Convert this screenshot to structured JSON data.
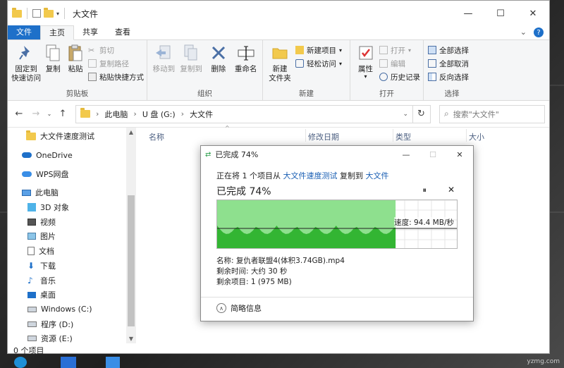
{
  "window": {
    "title": "大文件",
    "controls": {
      "minimize": "—",
      "maximize": "☐",
      "close": "✕"
    }
  },
  "tabs": [
    {
      "label": "文件"
    },
    {
      "label": "主页"
    },
    {
      "label": "共享"
    },
    {
      "label": "查看"
    }
  ],
  "ribbon": {
    "clipboard": {
      "label": "剪贴板",
      "pin": "固定到\n快速访问",
      "copy": "复制",
      "paste": "粘贴",
      "cut": "剪切",
      "copy_path": "复制路径",
      "paste_shortcut": "粘贴快捷方式"
    },
    "organize": {
      "label": "组织",
      "move_to": "移动到",
      "copy_to": "复制到",
      "delete": "删除",
      "rename": "重命名"
    },
    "new": {
      "label": "新建",
      "new_folder": "新建\n文件夹",
      "new_item": "新建项目",
      "easy_access": "轻松访问"
    },
    "open": {
      "label": "打开",
      "properties": "属性",
      "open": "打开",
      "edit": "编辑",
      "history": "历史记录"
    },
    "select": {
      "label": "选择",
      "select_all": "全部选择",
      "select_none": "全部取消",
      "invert": "反向选择"
    }
  },
  "address": {
    "path": [
      "此电脑",
      "U 盘 (G:)",
      "大文件"
    ],
    "search_placeholder": "搜索\"大文件\""
  },
  "sidebar": {
    "items": [
      {
        "label": "大文件速度测试",
        "icon": "folder-icon"
      },
      {
        "label": "OneDrive",
        "icon": "cloud-icon"
      },
      {
        "label": "WPS网盘",
        "icon": "cloud-icon"
      },
      {
        "label": "此电脑",
        "icon": "computer-icon"
      },
      {
        "label": "3D 对象",
        "icon": "cube-icon"
      },
      {
        "label": "视频",
        "icon": "video-icon"
      },
      {
        "label": "图片",
        "icon": "picture-icon"
      },
      {
        "label": "文档",
        "icon": "document-icon"
      },
      {
        "label": "下载",
        "icon": "download-icon"
      },
      {
        "label": "音乐",
        "icon": "music-icon"
      },
      {
        "label": "桌面",
        "icon": "desktop-icon"
      },
      {
        "label": "Windows (C:)",
        "icon": "drive-icon"
      },
      {
        "label": "程序 (D:)",
        "icon": "drive-icon"
      },
      {
        "label": "资源 (E:)",
        "icon": "drive-icon"
      }
    ]
  },
  "columns": {
    "name": "名称",
    "modified": "修改日期",
    "type": "类型",
    "size": "大小"
  },
  "status": {
    "item_count": "0 个项目"
  },
  "copy_dialog": {
    "title": "已完成 74%",
    "progress": 0.74,
    "line_prefix": "正在将 1 个项目从",
    "source": "大文件速度测试",
    "line_mid": "复制到",
    "dest": "大文件",
    "percent_text": "已完成 74%",
    "speed": "速度: 94.4 MB/秒",
    "name_line": "名称: 复仇者联盟4(体积3.74GB).mp4",
    "remaining_time": "剩余时间: 大约 30 秒",
    "remaining_items": "剩余项目: 1 (975 MB)",
    "less_details": "简略信息",
    "pause": "⏸",
    "close": "✕",
    "controls": {
      "minimize": "—",
      "maximize": "☐",
      "close": "✕"
    }
  },
  "watermark": "yzmg.com",
  "colors": {
    "accent": "#1e70c9",
    "graph_fill": "#8ee08e",
    "graph_bar": "#33b533"
  }
}
